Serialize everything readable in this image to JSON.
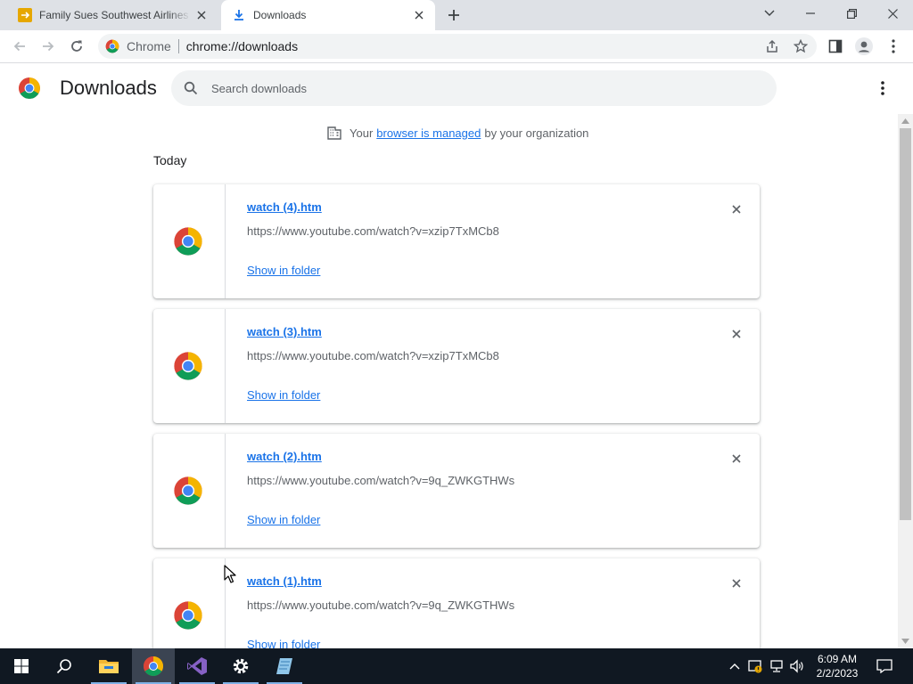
{
  "colors": {
    "tabstrip": "#dee1e6",
    "link": "#1a73e8",
    "taskbar": "#101822",
    "tab_favicon": "#e6a700"
  },
  "tabs": [
    {
      "title": "Family Sues Southwest Airlines For...",
      "favicon": "airplane-favicon",
      "active": false
    },
    {
      "title": "Downloads",
      "favicon": "download-icon",
      "active": true
    }
  ],
  "window_controls": [
    "tab-search-icon",
    "minimize-icon",
    "restore-icon",
    "close-icon"
  ],
  "omnibox": {
    "site_label": "Chrome",
    "url": "chrome://downloads",
    "icons": [
      "share-icon",
      "star-icon"
    ]
  },
  "toolbar_icons": [
    "side-panel-icon",
    "profile-icon",
    "menu-icon"
  ],
  "downloads_page": {
    "title": "Downloads",
    "search_placeholder": "Search downloads",
    "managed": {
      "prefix": "Your",
      "link": "browser is managed",
      "suffix": "by your organization"
    },
    "section": "Today",
    "items": [
      {
        "file": "watch (4).htm",
        "url": "https://www.youtube.com/watch?v=xzip7TxMCb8",
        "action": "Show in folder"
      },
      {
        "file": "watch (3).htm",
        "url": "https://www.youtube.com/watch?v=xzip7TxMCb8",
        "action": "Show in folder"
      },
      {
        "file": "watch (2).htm",
        "url": "https://www.youtube.com/watch?v=9q_ZWKGTHWs",
        "action": "Show in folder"
      },
      {
        "file": "watch (1).htm",
        "url": "https://www.youtube.com/watch?v=9q_ZWKGTHWs",
        "action": "Show in folder"
      }
    ]
  },
  "taskbar": {
    "apps": [
      "windows-start-icon",
      "search-icon",
      "file-explorer-icon",
      "chrome-icon",
      "visual-studio-icon",
      "settings-icon",
      "notepad-icon"
    ],
    "tray_icons": [
      "chevron-up-icon",
      "security-icon",
      "network-icon",
      "volume-icon"
    ],
    "time": "6:09 AM",
    "date": "2/2/2023",
    "notification_icon": "notification-icon"
  }
}
